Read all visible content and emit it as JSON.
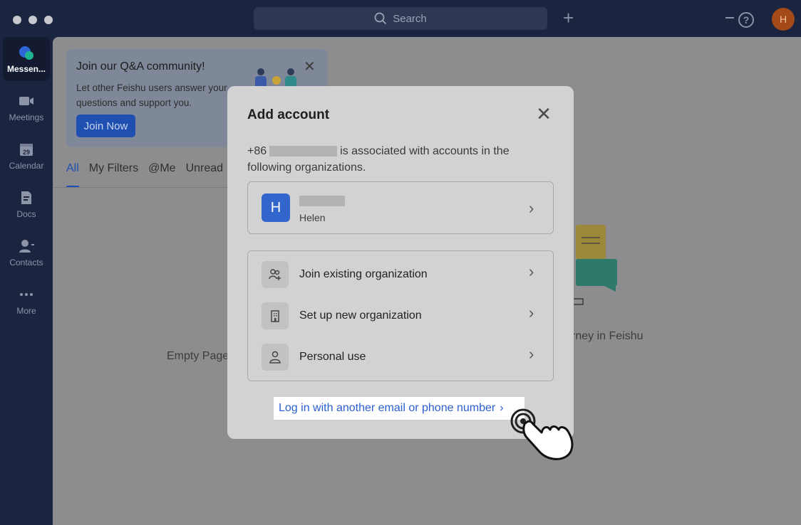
{
  "titlebar": {
    "search_placeholder": "Search",
    "user_initial": "H"
  },
  "sidebar": {
    "items": [
      {
        "label": "Messen...",
        "icon": "messenger-icon",
        "active": true
      },
      {
        "label": "Meetings",
        "icon": "video-camera-icon"
      },
      {
        "label": "Calendar",
        "icon": "calendar-icon",
        "day": "29"
      },
      {
        "label": "Docs",
        "icon": "docs-icon"
      },
      {
        "label": "Contacts",
        "icon": "contacts-icon"
      },
      {
        "label": "More",
        "icon": "more-dots-icon"
      }
    ]
  },
  "banner": {
    "title": "Join our Q&A community!",
    "text": "Let other Feishu users answer your questions and support you.",
    "button": "Join Now"
  },
  "tabs": [
    "All",
    "My Filters",
    "@Me",
    "Unread"
  ],
  "main": {
    "empty_page": "Empty Page",
    "journey_text": "rney in Feishu"
  },
  "modal": {
    "title": "Add account",
    "desc_prefix": "+86",
    "desc_suffix": "is associated with accounts in the following organizations.",
    "org": {
      "initial": "H",
      "user_name": "Helen"
    },
    "options": [
      {
        "label": "Join existing organization",
        "icon": "join-organization-icon"
      },
      {
        "label": "Set up new organization",
        "icon": "building-icon"
      },
      {
        "label": "Personal use",
        "icon": "person-icon"
      }
    ],
    "login_link": "Log in with another email or phone number"
  },
  "colors": {
    "accent": "#3366cc",
    "link": "#2a5fd0",
    "sidebar_bg": "#1c2540"
  }
}
